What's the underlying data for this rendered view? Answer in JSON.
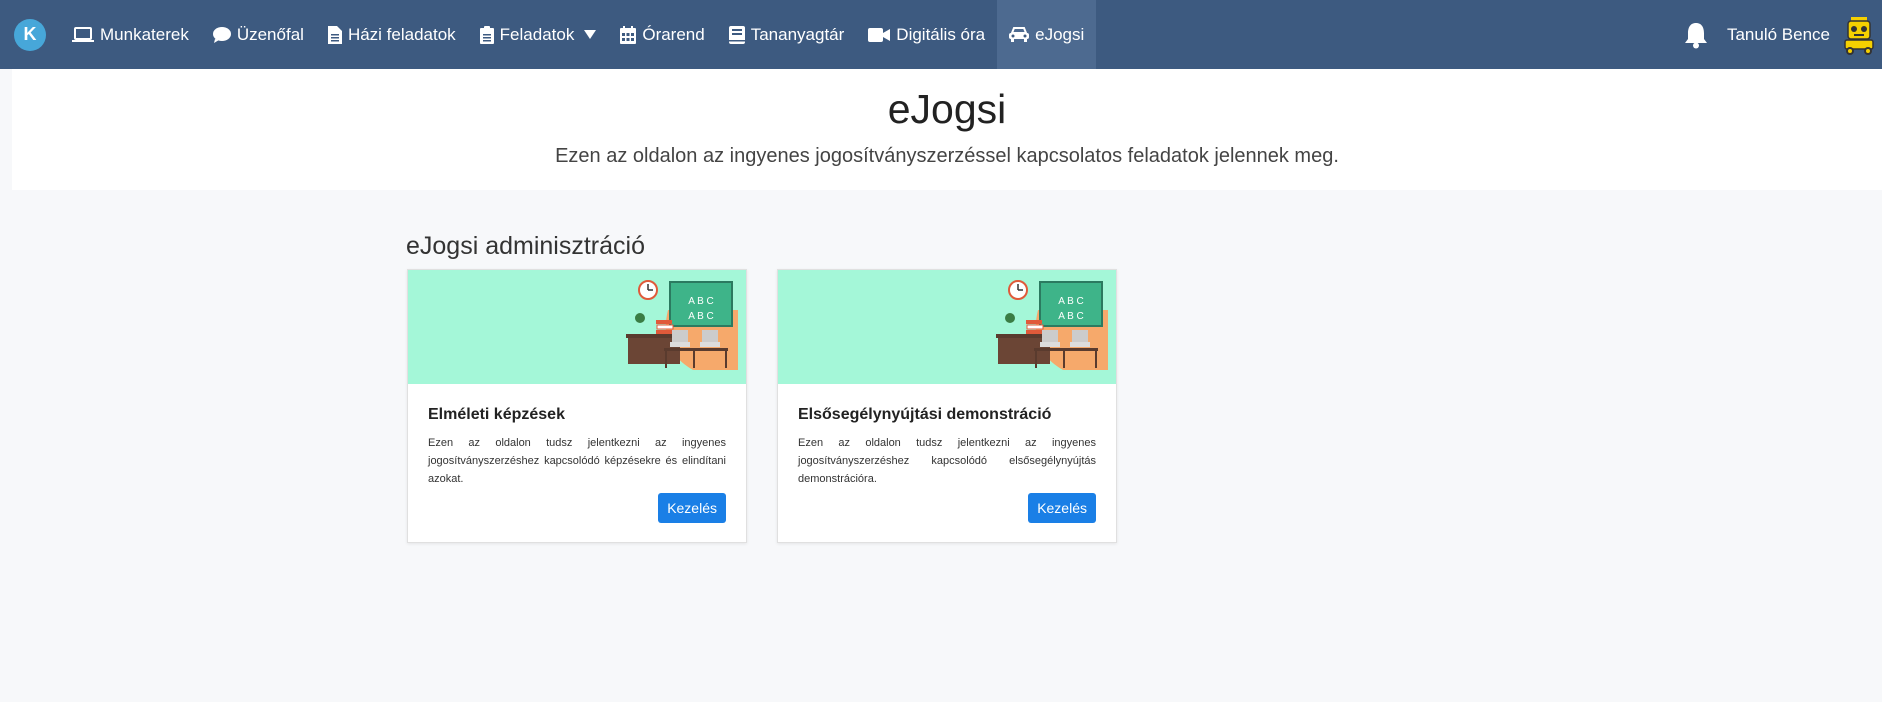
{
  "nav": {
    "logo": "K",
    "items": [
      {
        "label": "Munkaterek",
        "icon": "laptop-icon"
      },
      {
        "label": "Üzenőfal",
        "icon": "chat-bubble-icon"
      },
      {
        "label": "Házi feladatok",
        "icon": "document-icon"
      },
      {
        "label": "Feladatok",
        "icon": "clipboard-icon"
      },
      {
        "label": "Órarend",
        "icon": "calendar-icon"
      },
      {
        "label": "Tananyagtár",
        "icon": "book-icon"
      },
      {
        "label": "Digitális óra",
        "icon": "video-camera-icon"
      },
      {
        "label": "eJogsi",
        "icon": "car-icon"
      }
    ],
    "user_name": "Tanuló Bence"
  },
  "hero": {
    "title": "eJogsi",
    "subtitle": "Ezen az oldalon az ingyenes jogosítványszerzéssel kapcsolatos feladatok jelennek meg."
  },
  "section_title": "eJogsi adminisztráció",
  "cards": [
    {
      "title": "Elméleti képzések",
      "text": "Ezen az oldalon tudsz jelentkezni az ingyenes jogosítványszerzéshez kapcsolódó képzésekre és elindítani azokat.",
      "button": "Kezelés"
    },
    {
      "title": "Elsősegélynyújtási demonstráció",
      "text": "Ezen az oldalon tudsz jelentkezni az ingyenes jogosítványszerzéshez kapcsolódó elsősegélynyújtás demonstrációra.",
      "button": "Kezelés"
    }
  ],
  "illustration": {
    "board_text_row1": "A B C",
    "board_text_row2": "A B C"
  },
  "colors": {
    "navbar": "#3d5a80",
    "accent_button": "#1a7fe6",
    "card_header": "#a4f7d8"
  }
}
